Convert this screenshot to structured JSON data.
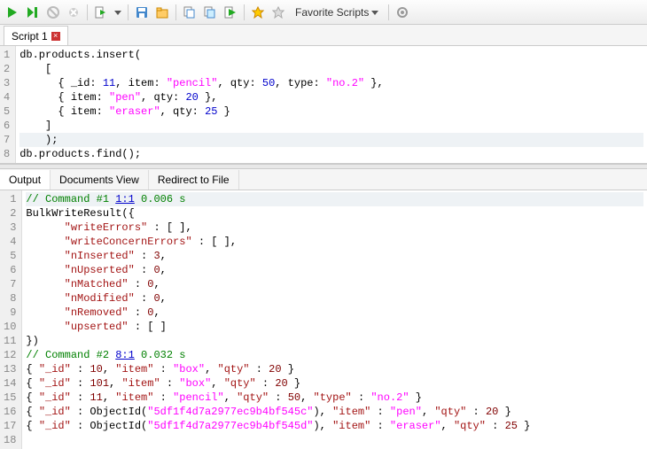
{
  "toolbar": {
    "fav_label": "Favorite Scripts",
    "icons": [
      "run",
      "run-step",
      "stop",
      "cancel",
      "run-script",
      "run-script-dd",
      "save",
      "open",
      "copy-doc",
      "copy-doc2",
      "run-green",
      "star",
      "star-grey",
      "fav",
      "gear"
    ]
  },
  "script_tab": {
    "label": "Script 1"
  },
  "editor": {
    "lines": [
      {
        "n": 1,
        "segs": [
          {
            "t": "db.products.insert("
          }
        ]
      },
      {
        "n": 2,
        "segs": [
          {
            "t": "    ["
          }
        ]
      },
      {
        "n": 3,
        "segs": [
          {
            "t": "      { _id: "
          },
          {
            "t": "11",
            "c": "m-num"
          },
          {
            "t": ", item: "
          },
          {
            "t": "\"pencil\"",
            "c": "m-str"
          },
          {
            "t": ", qty: "
          },
          {
            "t": "50",
            "c": "m-num"
          },
          {
            "t": ", type: "
          },
          {
            "t": "\"no.2\"",
            "c": "m-str"
          },
          {
            "t": " },"
          }
        ]
      },
      {
        "n": 4,
        "segs": [
          {
            "t": "      { item: "
          },
          {
            "t": "\"pen\"",
            "c": "m-str"
          },
          {
            "t": ", qty: "
          },
          {
            "t": "20",
            "c": "m-num"
          },
          {
            "t": " },"
          }
        ]
      },
      {
        "n": 5,
        "segs": [
          {
            "t": "      { item: "
          },
          {
            "t": "\"eraser\"",
            "c": "m-str"
          },
          {
            "t": ", qty: "
          },
          {
            "t": "25",
            "c": "m-num"
          },
          {
            "t": " }"
          }
        ]
      },
      {
        "n": 6,
        "segs": [
          {
            "t": "    ]"
          }
        ]
      },
      {
        "n": 7,
        "hl": true,
        "segs": [
          {
            "t": "    );"
          }
        ]
      },
      {
        "n": 8,
        "segs": [
          {
            "t": "db.products.find();"
          }
        ]
      }
    ]
  },
  "output_tabs": {
    "items": [
      "Output",
      "Documents View",
      "Redirect to File"
    ],
    "active": 0
  },
  "output": {
    "lines": [
      {
        "n": 1,
        "hl": true,
        "segs": [
          {
            "t": "// Command #1 ",
            "c": "m-cmt"
          },
          {
            "t": "1:1",
            "c": "m-u"
          },
          {
            "t": " 0.006 s",
            "c": "m-cmt"
          }
        ]
      },
      {
        "n": 2,
        "segs": [
          {
            "t": "BulkWriteResult({"
          }
        ]
      },
      {
        "n": 3,
        "segs": [
          {
            "t": "      "
          },
          {
            "t": "\"writeErrors\"",
            "c": "m-key"
          },
          {
            "t": " : [ ],"
          }
        ]
      },
      {
        "n": 4,
        "segs": [
          {
            "t": "      "
          },
          {
            "t": "\"writeConcernErrors\"",
            "c": "m-key"
          },
          {
            "t": " : [ ],"
          }
        ]
      },
      {
        "n": 5,
        "segs": [
          {
            "t": "      "
          },
          {
            "t": "\"nInserted\"",
            "c": "m-key"
          },
          {
            "t": " : "
          },
          {
            "t": "3",
            "c": "m-num2"
          },
          {
            "t": ","
          }
        ]
      },
      {
        "n": 6,
        "segs": [
          {
            "t": "      "
          },
          {
            "t": "\"nUpserted\"",
            "c": "m-key"
          },
          {
            "t": " : "
          },
          {
            "t": "0",
            "c": "m-num2"
          },
          {
            "t": ","
          }
        ]
      },
      {
        "n": 7,
        "segs": [
          {
            "t": "      "
          },
          {
            "t": "\"nMatched\"",
            "c": "m-key"
          },
          {
            "t": " : "
          },
          {
            "t": "0",
            "c": "m-num2"
          },
          {
            "t": ","
          }
        ]
      },
      {
        "n": 8,
        "segs": [
          {
            "t": "      "
          },
          {
            "t": "\"nModified\"",
            "c": "m-key"
          },
          {
            "t": " : "
          },
          {
            "t": "0",
            "c": "m-num2"
          },
          {
            "t": ","
          }
        ]
      },
      {
        "n": 9,
        "segs": [
          {
            "t": "      "
          },
          {
            "t": "\"nRemoved\"",
            "c": "m-key"
          },
          {
            "t": " : "
          },
          {
            "t": "0",
            "c": "m-num2"
          },
          {
            "t": ","
          }
        ]
      },
      {
        "n": 10,
        "segs": [
          {
            "t": "      "
          },
          {
            "t": "\"upserted\"",
            "c": "m-key"
          },
          {
            "t": " : [ ]"
          }
        ]
      },
      {
        "n": 11,
        "segs": [
          {
            "t": "})"
          }
        ]
      },
      {
        "n": 12,
        "segs": [
          {
            "t": "// Command #2 ",
            "c": "m-cmt"
          },
          {
            "t": "8:1",
            "c": "m-u"
          },
          {
            "t": " 0.032 s",
            "c": "m-cmt"
          }
        ]
      },
      {
        "n": 13,
        "segs": [
          {
            "t": "{ "
          },
          {
            "t": "\"_id\"",
            "c": "m-key"
          },
          {
            "t": " : "
          },
          {
            "t": "10",
            "c": "m-num2"
          },
          {
            "t": ", "
          },
          {
            "t": "\"item\"",
            "c": "m-key"
          },
          {
            "t": " : "
          },
          {
            "t": "\"box\"",
            "c": "m-str"
          },
          {
            "t": ", "
          },
          {
            "t": "\"qty\"",
            "c": "m-key"
          },
          {
            "t": " : "
          },
          {
            "t": "20",
            "c": "m-num2"
          },
          {
            "t": " }"
          }
        ]
      },
      {
        "n": 14,
        "segs": [
          {
            "t": "{ "
          },
          {
            "t": "\"_id\"",
            "c": "m-key"
          },
          {
            "t": " : "
          },
          {
            "t": "101",
            "c": "m-num2"
          },
          {
            "t": ", "
          },
          {
            "t": "\"item\"",
            "c": "m-key"
          },
          {
            "t": " : "
          },
          {
            "t": "\"box\"",
            "c": "m-str"
          },
          {
            "t": ", "
          },
          {
            "t": "\"qty\"",
            "c": "m-key"
          },
          {
            "t": " : "
          },
          {
            "t": "20",
            "c": "m-num2"
          },
          {
            "t": " }"
          }
        ]
      },
      {
        "n": 15,
        "segs": [
          {
            "t": "{ "
          },
          {
            "t": "\"_id\"",
            "c": "m-key"
          },
          {
            "t": " : "
          },
          {
            "t": "11",
            "c": "m-num2"
          },
          {
            "t": ", "
          },
          {
            "t": "\"item\"",
            "c": "m-key"
          },
          {
            "t": " : "
          },
          {
            "t": "\"pencil\"",
            "c": "m-str"
          },
          {
            "t": ", "
          },
          {
            "t": "\"qty\"",
            "c": "m-key"
          },
          {
            "t": " : "
          },
          {
            "t": "50",
            "c": "m-num2"
          },
          {
            "t": ", "
          },
          {
            "t": "\"type\"",
            "c": "m-key"
          },
          {
            "t": " : "
          },
          {
            "t": "\"no.2\"",
            "c": "m-str"
          },
          {
            "t": " }"
          }
        ]
      },
      {
        "n": 16,
        "segs": [
          {
            "t": "{ "
          },
          {
            "t": "\"_id\"",
            "c": "m-key"
          },
          {
            "t": " : ObjectId("
          },
          {
            "t": "\"5df1f4d7a2977ec9b4bf545c\"",
            "c": "m-str"
          },
          {
            "t": "), "
          },
          {
            "t": "\"item\"",
            "c": "m-key"
          },
          {
            "t": " : "
          },
          {
            "t": "\"pen\"",
            "c": "m-str"
          },
          {
            "t": ", "
          },
          {
            "t": "\"qty\"",
            "c": "m-key"
          },
          {
            "t": " : "
          },
          {
            "t": "20",
            "c": "m-num2"
          },
          {
            "t": " }"
          }
        ]
      },
      {
        "n": 17,
        "segs": [
          {
            "t": "{ "
          },
          {
            "t": "\"_id\"",
            "c": "m-key"
          },
          {
            "t": " : ObjectId("
          },
          {
            "t": "\"5df1f4d7a2977ec9b4bf545d\"",
            "c": "m-str"
          },
          {
            "t": "), "
          },
          {
            "t": "\"item\"",
            "c": "m-key"
          },
          {
            "t": " : "
          },
          {
            "t": "\"eraser\"",
            "c": "m-str"
          },
          {
            "t": ", "
          },
          {
            "t": "\"qty\"",
            "c": "m-key"
          },
          {
            "t": " : "
          },
          {
            "t": "25",
            "c": "m-num2"
          },
          {
            "t": " }"
          }
        ]
      },
      {
        "n": 18,
        "segs": [
          {
            "t": ""
          }
        ]
      }
    ]
  },
  "chart_data": {
    "type": "table",
    "title": "db.products.find() result",
    "series": [
      {
        "_id": 10,
        "item": "box",
        "qty": 20
      },
      {
        "_id": 101,
        "item": "box",
        "qty": 20
      },
      {
        "_id": 11,
        "item": "pencil",
        "qty": 50,
        "type": "no.2"
      },
      {
        "_id": "ObjectId(5df1f4d7a2977ec9b4bf545c)",
        "item": "pen",
        "qty": 20
      },
      {
        "_id": "ObjectId(5df1f4d7a2977ec9b4bf545d)",
        "item": "eraser",
        "qty": 25
      }
    ],
    "bulk_write": {
      "writeErrors": [],
      "writeConcernErrors": [],
      "nInserted": 3,
      "nUpserted": 0,
      "nMatched": 0,
      "nModified": 0,
      "nRemoved": 0,
      "upserted": []
    }
  }
}
